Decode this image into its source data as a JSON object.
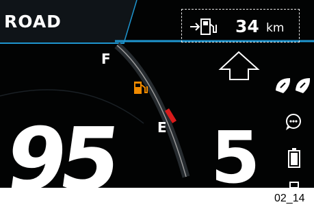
{
  "dashboard": {
    "mode": "ROAD",
    "range": {
      "value": "34",
      "unit": "km"
    },
    "fuel_gauge": {
      "full_label": "F",
      "empty_label": "E"
    },
    "speed": "95",
    "gear": "5"
  },
  "indicators": [
    "helmet-icons",
    "chat-icon",
    "battery-icon"
  ],
  "figure_label": "02_14",
  "colors": {
    "background": "#020303",
    "accent": "#1e95cf",
    "fuel_warning": "#f08a00",
    "gauge_red": "#d81b1b",
    "text": "#ffffff"
  }
}
